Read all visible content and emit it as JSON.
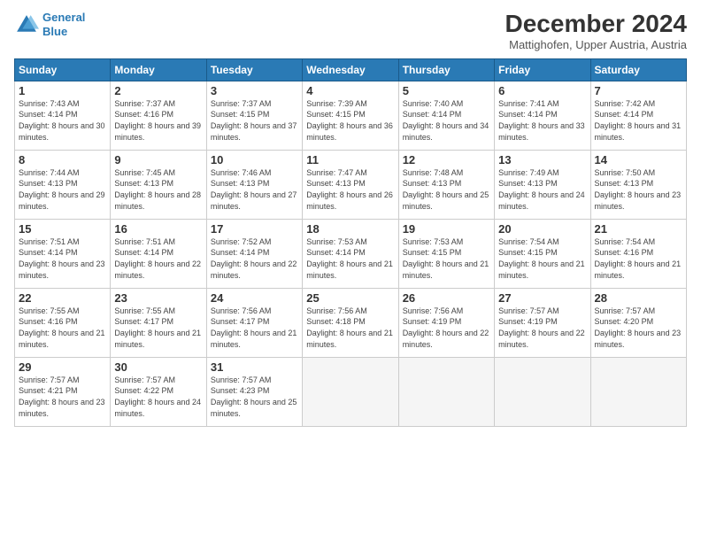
{
  "header": {
    "logo_line1": "General",
    "logo_line2": "Blue",
    "month": "December 2024",
    "location": "Mattighofen, Upper Austria, Austria"
  },
  "weekdays": [
    "Sunday",
    "Monday",
    "Tuesday",
    "Wednesday",
    "Thursday",
    "Friday",
    "Saturday"
  ],
  "days": [
    {
      "num": "",
      "empty": true
    },
    {
      "num": "",
      "empty": true
    },
    {
      "num": "",
      "empty": true
    },
    {
      "num": "",
      "empty": true
    },
    {
      "num": "",
      "empty": true
    },
    {
      "num": "",
      "empty": true
    },
    {
      "num": "1",
      "sunrise": "7:43 AM",
      "sunset": "4:14 PM",
      "daylight": "8 hours and 30 minutes."
    },
    {
      "num": "2",
      "sunrise": "7:37 AM",
      "sunset": "4:16 PM",
      "daylight": "8 hours and 39 minutes."
    },
    {
      "num": "3",
      "sunrise": "7:37 AM",
      "sunset": "4:15 PM",
      "daylight": "8 hours and 37 minutes."
    },
    {
      "num": "4",
      "sunrise": "7:39 AM",
      "sunset": "4:15 PM",
      "daylight": "8 hours and 36 minutes."
    },
    {
      "num": "5",
      "sunrise": "7:40 AM",
      "sunset": "4:14 PM",
      "daylight": "8 hours and 34 minutes."
    },
    {
      "num": "6",
      "sunrise": "7:41 AM",
      "sunset": "4:14 PM",
      "daylight": "8 hours and 33 minutes."
    },
    {
      "num": "7",
      "sunrise": "7:42 AM",
      "sunset": "4:14 PM",
      "daylight": "8 hours and 31 minutes."
    },
    {
      "num": "8",
      "sunrise": "7:44 AM",
      "sunset": "4:13 PM",
      "daylight": "8 hours and 29 minutes."
    },
    {
      "num": "9",
      "sunrise": "7:45 AM",
      "sunset": "4:13 PM",
      "daylight": "8 hours and 28 minutes."
    },
    {
      "num": "10",
      "sunrise": "7:46 AM",
      "sunset": "4:13 PM",
      "daylight": "8 hours and 27 minutes."
    },
    {
      "num": "11",
      "sunrise": "7:47 AM",
      "sunset": "4:13 PM",
      "daylight": "8 hours and 26 minutes."
    },
    {
      "num": "12",
      "sunrise": "7:48 AM",
      "sunset": "4:13 PM",
      "daylight": "8 hours and 25 minutes."
    },
    {
      "num": "13",
      "sunrise": "7:49 AM",
      "sunset": "4:13 PM",
      "daylight": "8 hours and 24 minutes."
    },
    {
      "num": "14",
      "sunrise": "7:50 AM",
      "sunset": "4:13 PM",
      "daylight": "8 hours and 23 minutes."
    },
    {
      "num": "15",
      "sunrise": "7:51 AM",
      "sunset": "4:14 PM",
      "daylight": "8 hours and 23 minutes."
    },
    {
      "num": "16",
      "sunrise": "7:51 AM",
      "sunset": "4:14 PM",
      "daylight": "8 hours and 22 minutes."
    },
    {
      "num": "17",
      "sunrise": "7:52 AM",
      "sunset": "4:14 PM",
      "daylight": "8 hours and 22 minutes."
    },
    {
      "num": "18",
      "sunrise": "7:53 AM",
      "sunset": "4:14 PM",
      "daylight": "8 hours and 21 minutes."
    },
    {
      "num": "19",
      "sunrise": "7:53 AM",
      "sunset": "4:15 PM",
      "daylight": "8 hours and 21 minutes."
    },
    {
      "num": "20",
      "sunrise": "7:54 AM",
      "sunset": "4:15 PM",
      "daylight": "8 hours and 21 minutes."
    },
    {
      "num": "21",
      "sunrise": "7:54 AM",
      "sunset": "4:16 PM",
      "daylight": "8 hours and 21 minutes."
    },
    {
      "num": "22",
      "sunrise": "7:55 AM",
      "sunset": "4:16 PM",
      "daylight": "8 hours and 21 minutes."
    },
    {
      "num": "23",
      "sunrise": "7:55 AM",
      "sunset": "4:17 PM",
      "daylight": "8 hours and 21 minutes."
    },
    {
      "num": "24",
      "sunrise": "7:56 AM",
      "sunset": "4:17 PM",
      "daylight": "8 hours and 21 minutes."
    },
    {
      "num": "25",
      "sunrise": "7:56 AM",
      "sunset": "4:18 PM",
      "daylight": "8 hours and 21 minutes."
    },
    {
      "num": "26",
      "sunrise": "7:56 AM",
      "sunset": "4:19 PM",
      "daylight": "8 hours and 22 minutes."
    },
    {
      "num": "27",
      "sunrise": "7:57 AM",
      "sunset": "4:19 PM",
      "daylight": "8 hours and 22 minutes."
    },
    {
      "num": "28",
      "sunrise": "7:57 AM",
      "sunset": "4:20 PM",
      "daylight": "8 hours and 23 minutes."
    },
    {
      "num": "29",
      "sunrise": "7:57 AM",
      "sunset": "4:21 PM",
      "daylight": "8 hours and 23 minutes."
    },
    {
      "num": "30",
      "sunrise": "7:57 AM",
      "sunset": "4:22 PM",
      "daylight": "8 hours and 24 minutes."
    },
    {
      "num": "31",
      "sunrise": "7:57 AM",
      "sunset": "4:23 PM",
      "daylight": "8 hours and 25 minutes."
    },
    {
      "num": "",
      "empty": true
    },
    {
      "num": "",
      "empty": true
    },
    {
      "num": "",
      "empty": true
    },
    {
      "num": "",
      "empty": true
    },
    {
      "num": "",
      "empty": true
    }
  ]
}
